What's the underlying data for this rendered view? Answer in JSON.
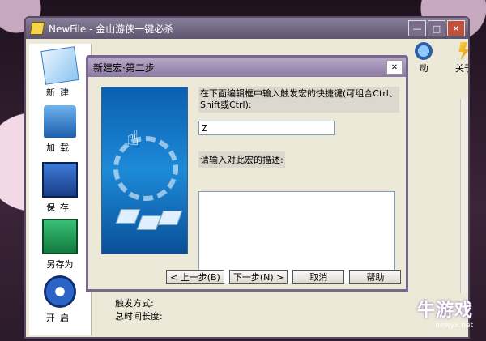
{
  "main_window": {
    "title": "NewFile - 金山游侠一键必杀",
    "minimize": "—",
    "maximize": "□",
    "close": "✕"
  },
  "toolbar": {
    "play_label": "动",
    "about_label": "关于"
  },
  "sidebar": {
    "items": [
      {
        "label": "新建",
        "icon": "new-file-icon"
      },
      {
        "label": "加载",
        "icon": "folder-icon"
      },
      {
        "label": "保存",
        "icon": "floppy-icon"
      },
      {
        "label": "另存为",
        "icon": "floppy-green-icon"
      },
      {
        "label": "开启",
        "icon": "play-circle-icon"
      }
    ]
  },
  "info": {
    "trigger_mode": "触发方式:",
    "total_time": "总时间长度:"
  },
  "dialog": {
    "title": "新建宏·第二步",
    "close": "✕",
    "hotkey_prompt": "在下面编辑框中输入触发宏的快捷键(可组合Ctrl、Shift或Ctrl):",
    "hotkey_value": "Z",
    "desc_label": "请输入对此宏的描述:",
    "desc_value": "",
    "buttons": {
      "prev": "< 上一步(B)",
      "next": "下一步(N) >",
      "cancel": "取消",
      "help": "帮助"
    }
  },
  "watermark": {
    "text": "牛游戏",
    "url": "newyx.net"
  }
}
